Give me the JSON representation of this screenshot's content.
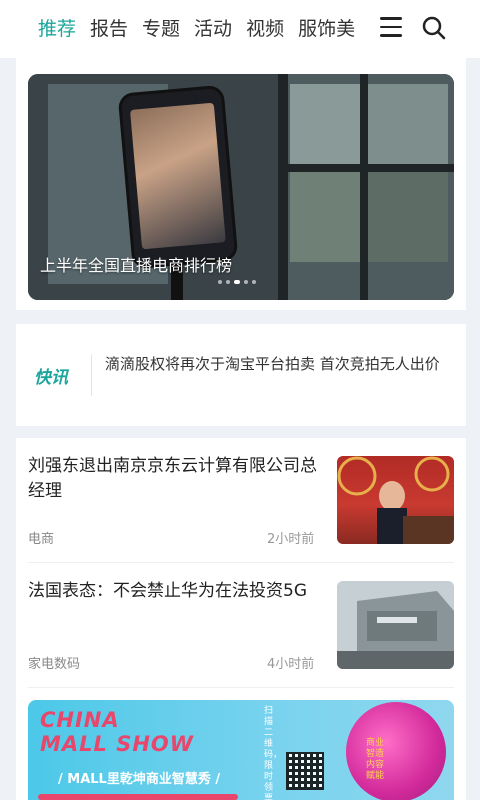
{
  "nav": {
    "tabs": [
      "推荐",
      "报告",
      "专题",
      "活动",
      "视频",
      "服饰美"
    ],
    "active_tab": 0,
    "accent_color": "#1ba59b",
    "menu_icon": "menu-icon",
    "search_icon": "search-icon"
  },
  "banner": {
    "title": "上半年全国直播电商排行榜",
    "dots_count": 5,
    "active_dot": 2
  },
  "flash": {
    "badge": "快讯",
    "text": "滴滴股权将再次于淘宝平台拍卖 首次竞拍无人出价"
  },
  "news": [
    {
      "title": "刘强东退出南京京东云计算有限公司总经理",
      "category": "电商",
      "time": "2小时前"
    },
    {
      "title": "法国表态：不会禁止华为在法投资5G",
      "category": "家电数码",
      "time": "4小时前"
    }
  ],
  "ad": {
    "title_line1": "CHINA",
    "title_line2": "MALL SHOW",
    "subtitle": "/ MALL里乾坤商业智慧秀 /",
    "side_text": "扫描二维码，限时领票",
    "brain_text": "商业智造内容赋能"
  }
}
